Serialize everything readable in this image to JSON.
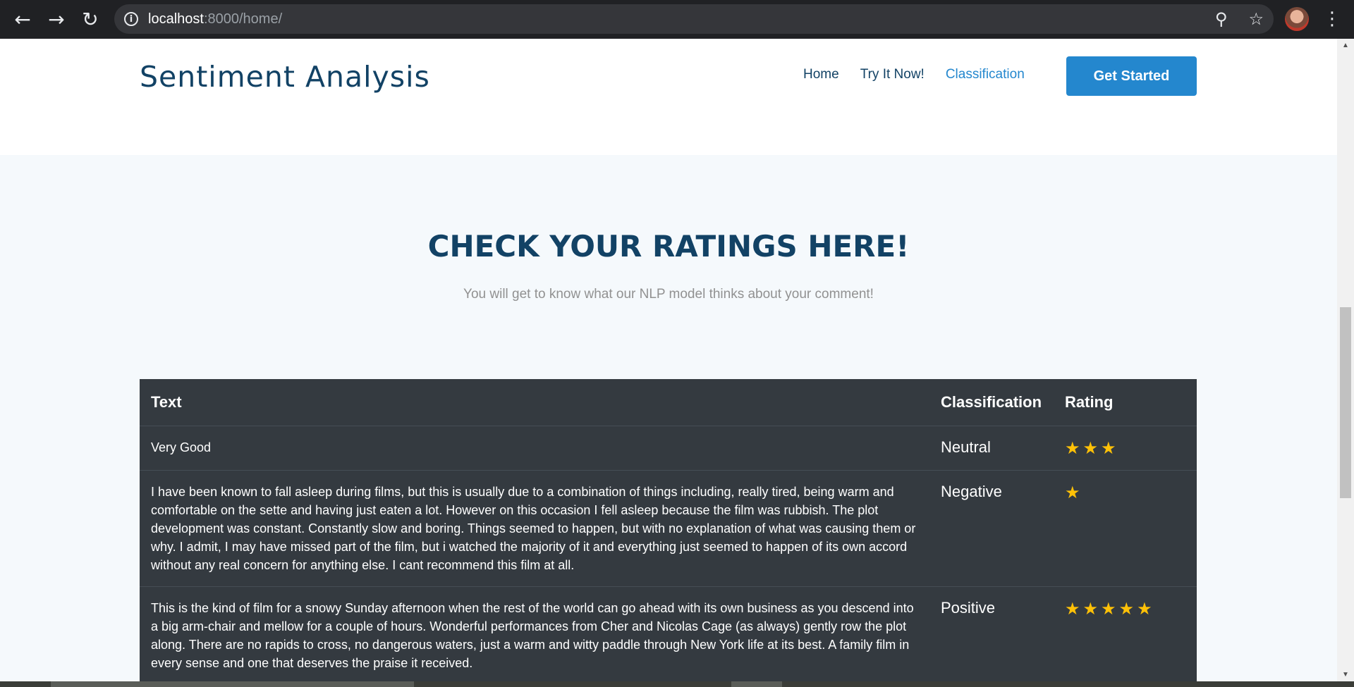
{
  "browser": {
    "url_host": "localhost",
    "url_rest": ":8000/home/",
    "back_icon": "arrow-left-icon",
    "forward_icon": "arrow-right-icon",
    "reload_icon": "reload-icon"
  },
  "header": {
    "logo": "Sentiment Analysis",
    "menu": [
      {
        "label": "Home",
        "active": false
      },
      {
        "label": "Try It Now!",
        "active": false
      },
      {
        "label": "Classification",
        "active": true
      }
    ],
    "cta": "Get Started"
  },
  "section": {
    "title": "CHECK YOUR RATINGS HERE!",
    "subtitle": "You will get to know what our NLP model thinks about your comment!"
  },
  "table": {
    "headers": [
      "Text",
      "Classification",
      "Rating"
    ],
    "rows": [
      {
        "text": "Very Good",
        "classification": "Neutral",
        "rating": 3
      },
      {
        "text": "I have been known to fall asleep during films, but this is usually due to a combination of things including, really tired, being warm and comfortable on the sette and having just eaten a lot. However on this occasion I fell asleep because the film was rubbish. The plot development was constant. Constantly slow and boring. Things seemed to happen, but with no explanation of what was causing them or why. I admit, I may have missed part of the film, but i watched the majority of it and everything just seemed to happen of its own accord without any real concern for anything else. I cant recommend this film at all.",
        "classification": "Negative",
        "rating": 1
      },
      {
        "text": "This is the kind of film for a snowy Sunday afternoon when the rest of the world can go ahead with its own business as you descend into a big arm-chair and mellow for a couple of hours. Wonderful performances from Cher and Nicolas Cage (as always) gently row the plot along. There are no rapids to cross, no dangerous waters, just a warm and witty paddle through New York life at its best. A family film in every sense and one that deserves the praise it received.",
        "classification": "Positive",
        "rating": 5
      }
    ]
  },
  "colors": {
    "brand": "#124265",
    "accent": "#2487ce",
    "table_bg": "#343a40",
    "star": "#ffc107"
  }
}
